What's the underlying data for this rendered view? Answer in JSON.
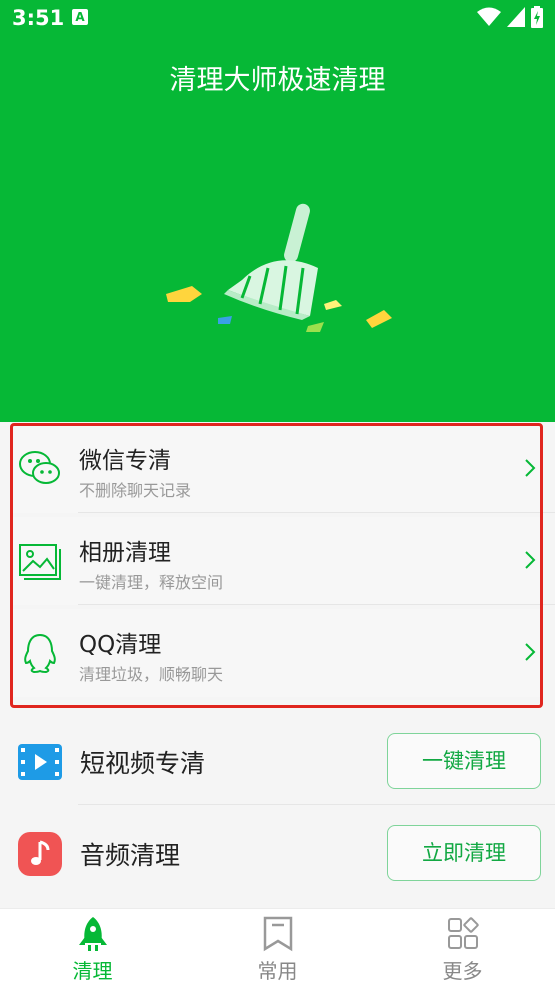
{
  "status_bar": {
    "time": "3:51",
    "notification": "A"
  },
  "header": {
    "title": "清理大师极速清理"
  },
  "clean_list": [
    {
      "title": "微信专清",
      "subtitle": "不删除聊天记录"
    },
    {
      "title": "相册清理",
      "subtitle": "一键清理，释放空间"
    },
    {
      "title": "QQ清理",
      "subtitle": "清理垃圾，顺畅聊天"
    }
  ],
  "actions": [
    {
      "title": "短视频专清",
      "button": "一键清理"
    },
    {
      "title": "音频清理",
      "button": "立即清理"
    }
  ],
  "bottom_nav": [
    {
      "label": "清理",
      "active": true
    },
    {
      "label": "常用",
      "active": false
    },
    {
      "label": "更多",
      "active": false
    }
  ],
  "colors": {
    "brand": "#06b836",
    "highlight": "#e0261f",
    "audio_icon": "#f05454",
    "video_icon": "#1e9be6"
  }
}
